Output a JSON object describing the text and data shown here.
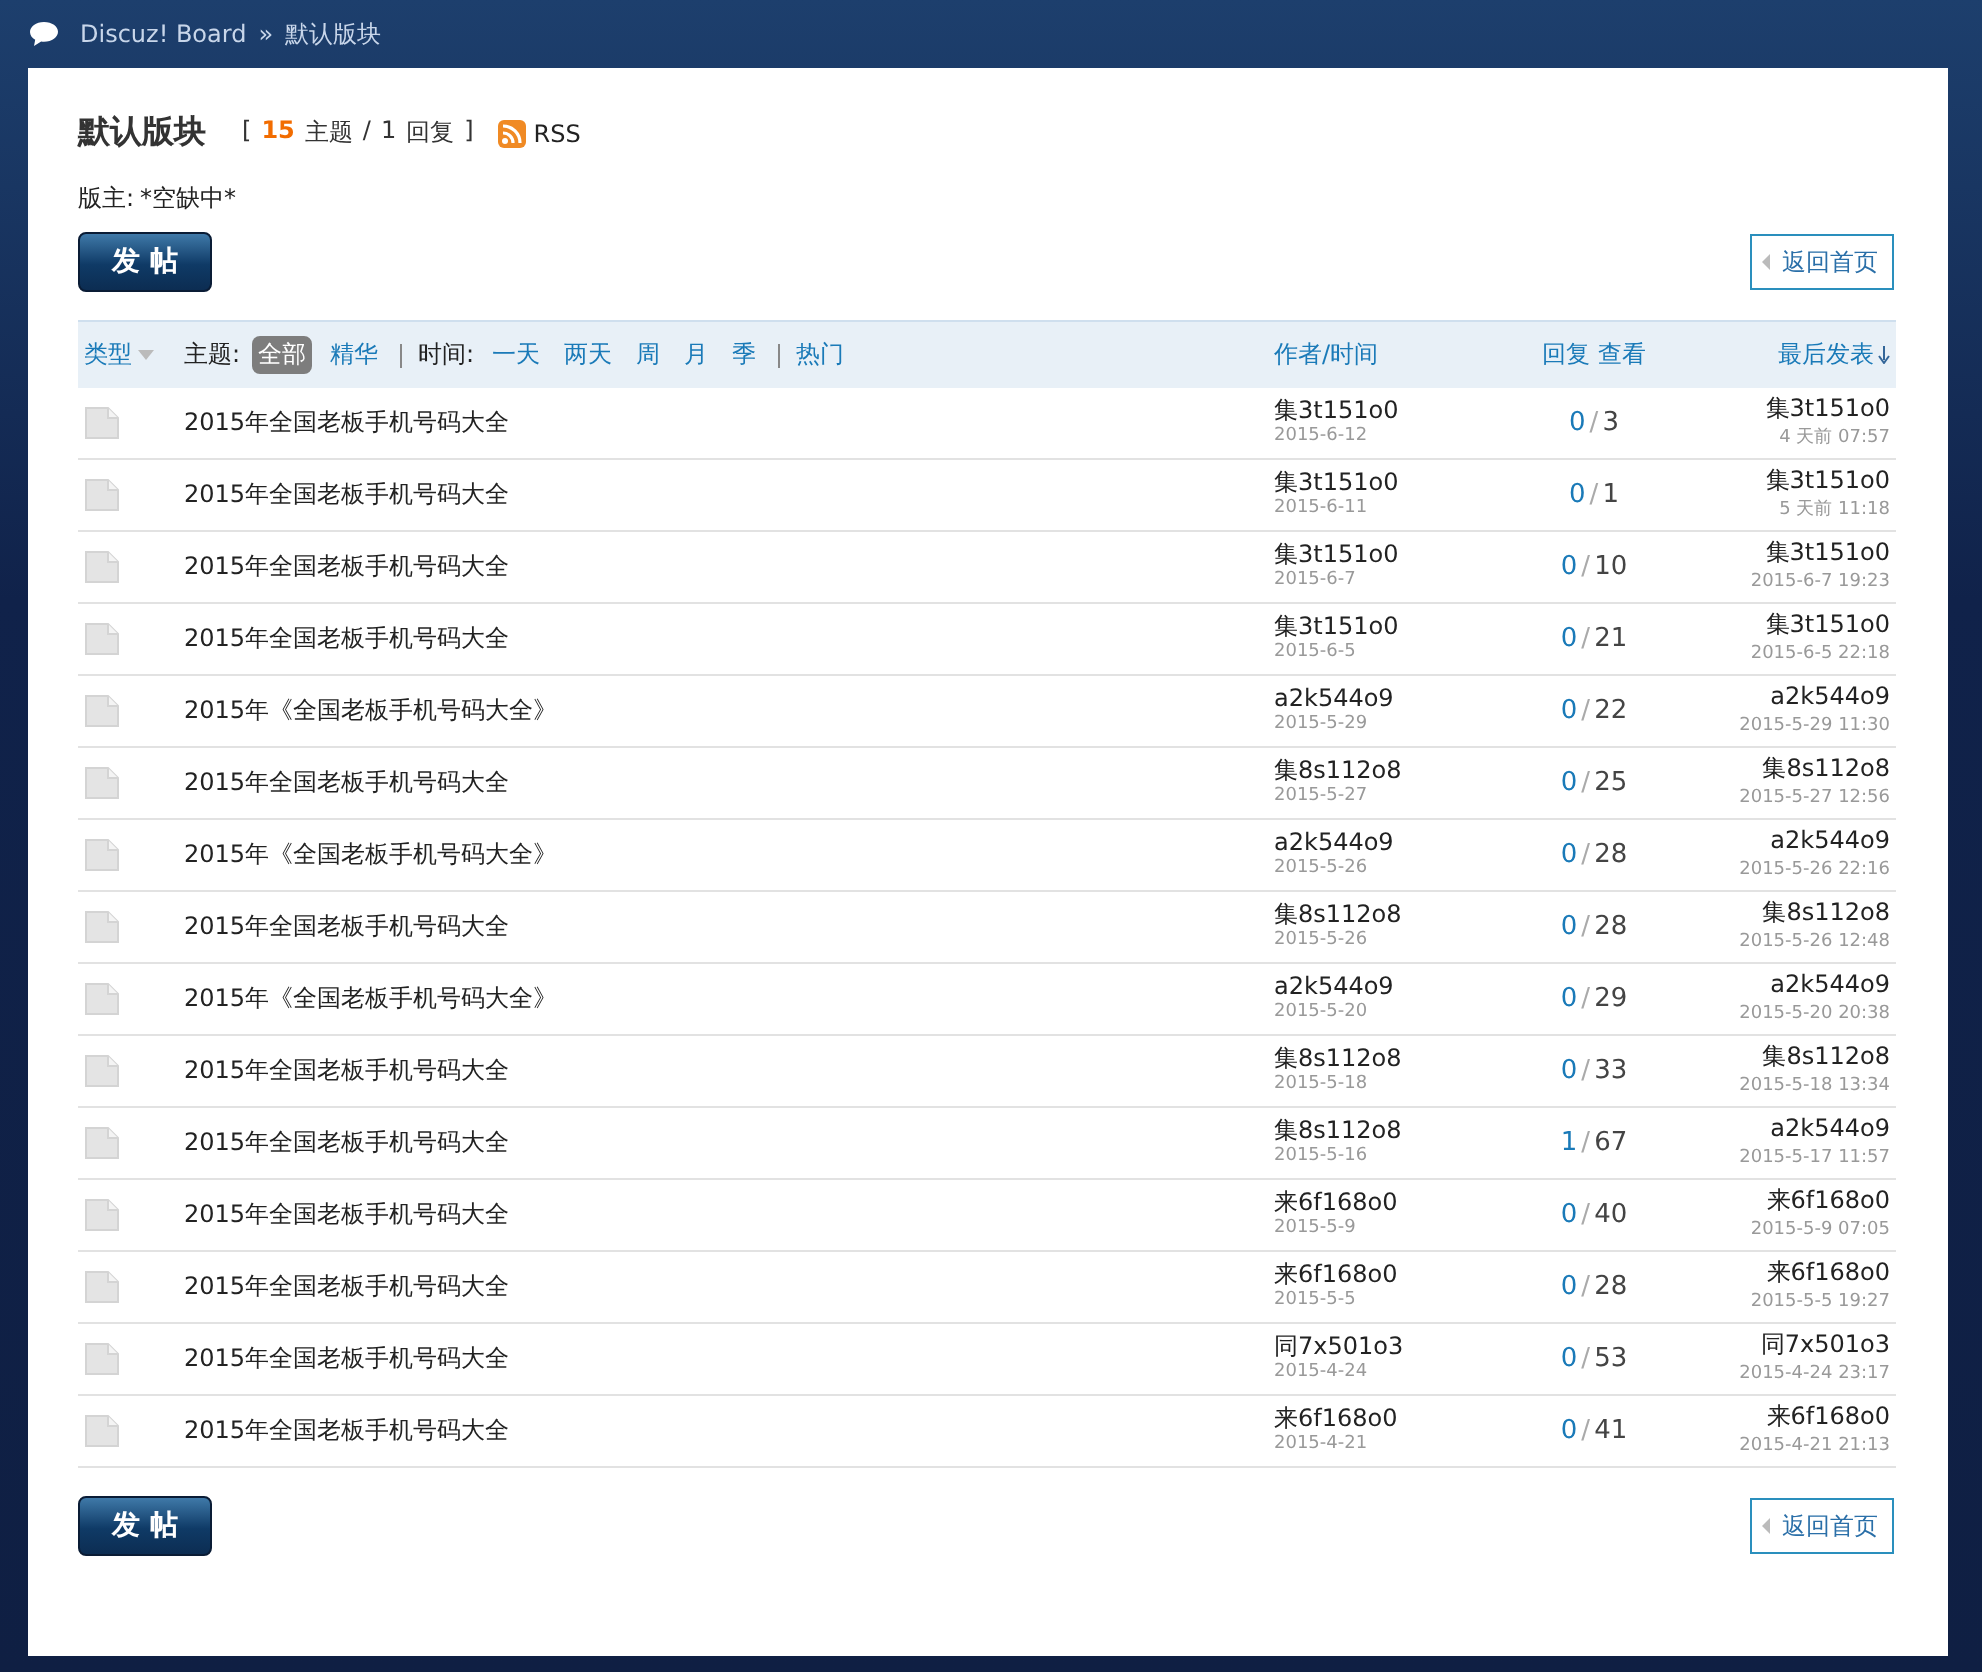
{
  "breadcrumb": {
    "site": "Discuz! Board",
    "separator": "»",
    "current": "默认版块"
  },
  "forum": {
    "title": "默认版块",
    "open_bracket": "[",
    "close_bracket": "]",
    "slash": "/",
    "topics_count": "15",
    "topics_label": "主题",
    "replies_count": "1",
    "replies_label": "回复",
    "rss": "RSS",
    "moderator_label": "版主:",
    "moderator": "*空缺中*"
  },
  "actions": [
    {
      "post_button": "发 帖",
      "back_button": "返回首页"
    },
    {
      "post_button": "发 帖",
      "back_button": "返回首页"
    }
  ],
  "count_separator": "/",
  "filters": {
    "type_label": "类型",
    "topic_label": "主题:",
    "topic_options": [
      {
        "label": "全部",
        "selected": true
      },
      {
        "label": "精华",
        "selected": false
      }
    ],
    "time_label": "时间:",
    "time_options": [
      {
        "label": "一天",
        "selected": false
      },
      {
        "label": "两天",
        "selected": false
      },
      {
        "label": "周",
        "selected": false
      },
      {
        "label": "月",
        "selected": false
      },
      {
        "label": "季",
        "selected": false
      }
    ],
    "hot": "热门"
  },
  "columns": {
    "author": "作者/时间",
    "replies": "回复",
    "views": "查看",
    "last_post": "最后发表"
  },
  "threads": [
    {
      "title": "2015年全国老板手机号码大全",
      "author": "集3t151o0",
      "date": "2015-6-12",
      "replies": "0",
      "views": "3",
      "last_author": "集3t151o0",
      "last_time": "4 天前 07:57"
    },
    {
      "title": "2015年全国老板手机号码大全",
      "author": "集3t151o0",
      "date": "2015-6-11",
      "replies": "0",
      "views": "1",
      "last_author": "集3t151o0",
      "last_time": "5 天前 11:18"
    },
    {
      "title": "2015年全国老板手机号码大全",
      "author": "集3t151o0",
      "date": "2015-6-7",
      "replies": "0",
      "views": "10",
      "last_author": "集3t151o0",
      "last_time": "2015-6-7 19:23"
    },
    {
      "title": "2015年全国老板手机号码大全",
      "author": "集3t151o0",
      "date": "2015-6-5",
      "replies": "0",
      "views": "21",
      "last_author": "集3t151o0",
      "last_time": "2015-6-5 22:18"
    },
    {
      "title": "2015年《全国老板手机号码大全》",
      "author": "a2k544o9",
      "date": "2015-5-29",
      "replies": "0",
      "views": "22",
      "last_author": "a2k544o9",
      "last_time": "2015-5-29 11:30"
    },
    {
      "title": "2015年全国老板手机号码大全",
      "author": "集8s112o8",
      "date": "2015-5-27",
      "replies": "0",
      "views": "25",
      "last_author": "集8s112o8",
      "last_time": "2015-5-27 12:56"
    },
    {
      "title": "2015年《全国老板手机号码大全》",
      "author": "a2k544o9",
      "date": "2015-5-26",
      "replies": "0",
      "views": "28",
      "last_author": "a2k544o9",
      "last_time": "2015-5-26 22:16"
    },
    {
      "title": "2015年全国老板手机号码大全",
      "author": "集8s112o8",
      "date": "2015-5-26",
      "replies": "0",
      "views": "28",
      "last_author": "集8s112o8",
      "last_time": "2015-5-26 12:48"
    },
    {
      "title": "2015年《全国老板手机号码大全》",
      "author": "a2k544o9",
      "date": "2015-5-20",
      "replies": "0",
      "views": "29",
      "last_author": "a2k544o9",
      "last_time": "2015-5-20 20:38"
    },
    {
      "title": "2015年全国老板手机号码大全",
      "author": "集8s112o8",
      "date": "2015-5-18",
      "replies": "0",
      "views": "33",
      "last_author": "集8s112o8",
      "last_time": "2015-5-18 13:34"
    },
    {
      "title": "2015年全国老板手机号码大全",
      "author": "集8s112o8",
      "date": "2015-5-16",
      "replies": "1",
      "views": "67",
      "last_author": "a2k544o9",
      "last_time": "2015-5-17 11:57"
    },
    {
      "title": "2015年全国老板手机号码大全",
      "author": "来6f168o0",
      "date": "2015-5-9",
      "replies": "0",
      "views": "40",
      "last_author": "来6f168o0",
      "last_time": "2015-5-9 07:05"
    },
    {
      "title": "2015年全国老板手机号码大全",
      "author": "来6f168o0",
      "date": "2015-5-5",
      "replies": "0",
      "views": "28",
      "last_author": "来6f168o0",
      "last_time": "2015-5-5 19:27"
    },
    {
      "title": "2015年全国老板手机号码大全",
      "author": "同7x501o3",
      "date": "2015-4-24",
      "replies": "0",
      "views": "53",
      "last_author": "同7x501o3",
      "last_time": "2015-4-24 23:17"
    },
    {
      "title": "2015年全国老板手机号码大全",
      "author": "来6f168o0",
      "date": "2015-4-21",
      "replies": "0",
      "views": "41",
      "last_author": "来6f168o0",
      "last_time": "2015-4-21 21:13"
    }
  ]
}
